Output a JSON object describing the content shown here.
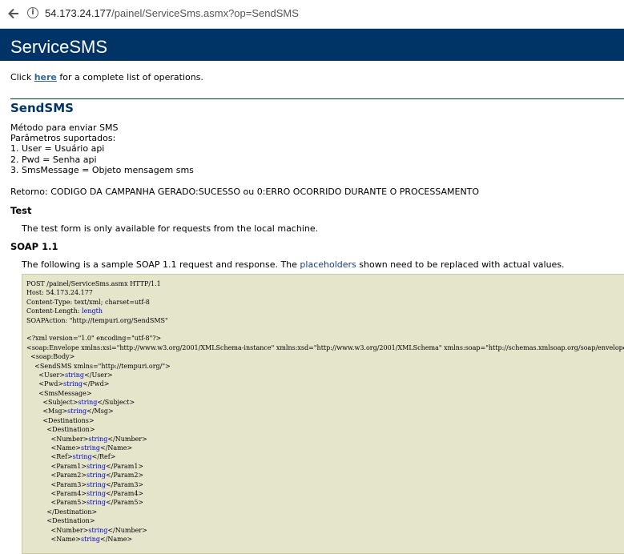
{
  "browser": {
    "url_host": "54.173.24.177",
    "url_path": "/painel/ServiceSms.asmx?op=SendSMS"
  },
  "header": {
    "title": "ServiceSMS"
  },
  "intro": {
    "prefix": "Click ",
    "link": "here",
    "suffix": " for a complete list of operations."
  },
  "operation": {
    "name": "SendSMS",
    "description_lines": [
      "Método para enviar SMS",
      "Parâmetros suportados:",
      "1. User = Usuário api",
      "2. Pwd = Senha api",
      "3. SmsMessage = Objeto mensagem sms"
    ],
    "retorno": "Retorno: CODIGO DA CAMPANHA GERADO:SUCESSO ou 0:ERRO OCORRIDO DURANTE O PROCESSAMENTO"
  },
  "test": {
    "heading": "Test",
    "text": "The test form is only available for requests from the local machine."
  },
  "soap": {
    "heading": "SOAP 1.1",
    "text_prefix": "The following is a sample SOAP 1.1 request and response. The ",
    "placeholder_word": "placeholders",
    "text_suffix": " shown need to be replaced with actual values.",
    "code_lines": [
      [
        "POST /painel/ServiceSms.asmx HTTP/1.1"
      ],
      [
        "Host: 54.173.24.177"
      ],
      [
        "Content-Type: text/xml; charset=utf-8"
      ],
      [
        "Content-Length: ",
        "length",
        ""
      ],
      [
        "SOAPAction: \"http://tempuri.org/SendSMS\""
      ],
      [
        ""
      ],
      [
        "<?xml version=\"1.0\" encoding=\"utf-8\"?>"
      ],
      [
        "<soap:Envelope xmlns:xsi=\"http://www.w3.org/2001/XMLSchema-instance\" xmlns:xsd=\"http://www.w3.org/2001/XMLSchema\" xmlns:soap=\"http://schemas.xmlsoap.org/soap/envelope/\">"
      ],
      [
        "  <soap:Body>"
      ],
      [
        "    <SendSMS xmlns=\"http://tempuri.org/\">"
      ],
      [
        "      <User>",
        "string",
        "</User>"
      ],
      [
        "      <Pwd>",
        "string",
        "</Pwd>"
      ],
      [
        "      <SmsMessage>"
      ],
      [
        "        <Subject>",
        "string",
        "</Subject>"
      ],
      [
        "        <Msg>",
        "string",
        "</Msg>"
      ],
      [
        "        <Destinations>"
      ],
      [
        "          <Destination>"
      ],
      [
        "            <Number>",
        "string",
        "</Number>"
      ],
      [
        "            <Name>",
        "string",
        "</Name>"
      ],
      [
        "            <Ref>",
        "string",
        "</Ref>"
      ],
      [
        "            <Param1>",
        "string",
        "</Param1>"
      ],
      [
        "            <Param2>",
        "string",
        "</Param2>"
      ],
      [
        "            <Param3>",
        "string",
        "</Param3>"
      ],
      [
        "            <Param4>",
        "string",
        "</Param4>"
      ],
      [
        "            <Param5>",
        "string",
        "</Param5>"
      ],
      [
        "          </Destination>"
      ],
      [
        "          <Destination>"
      ],
      [
        "            <Number>",
        "string",
        "</Number>"
      ],
      [
        "            <Name>",
        "string",
        "</Name>"
      ]
    ]
  },
  "colors": {
    "header_bg": "#003366",
    "heading": "#003366",
    "link": "#336699",
    "code_bg": "#e5e5cc",
    "placeholder": "#0000cc"
  },
  "icons": {
    "back": "back-arrow-icon",
    "info": "info-icon"
  }
}
